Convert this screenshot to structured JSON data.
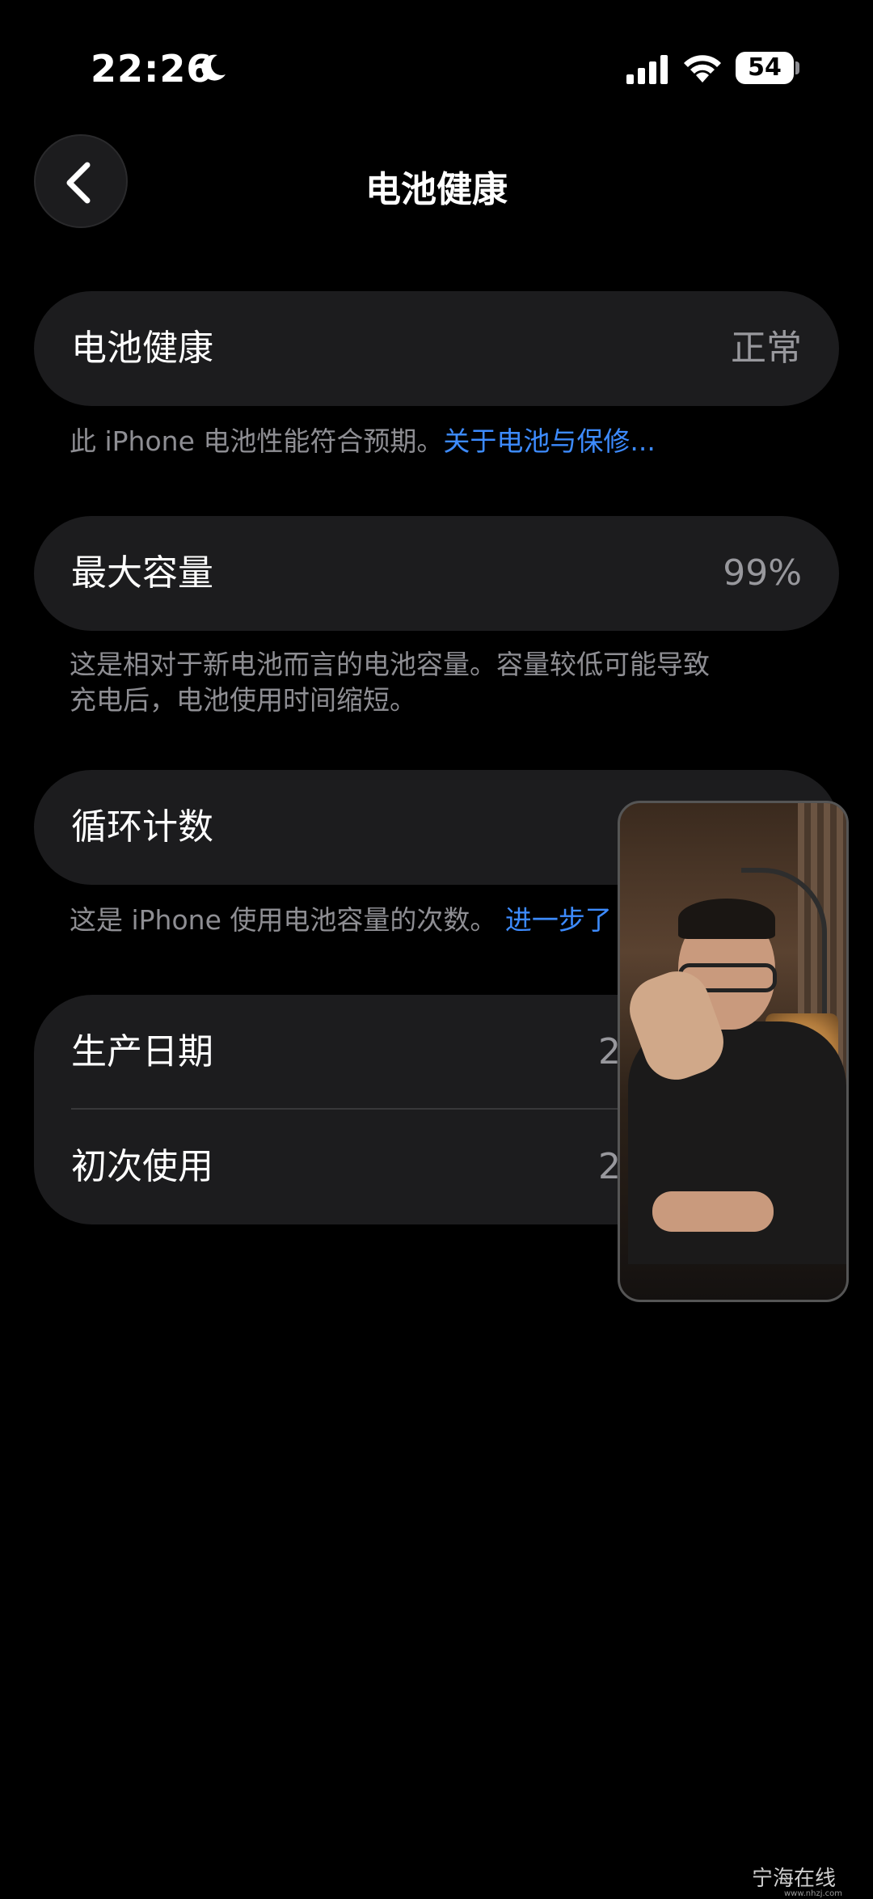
{
  "status_bar": {
    "time": "22:26",
    "battery_level": "54"
  },
  "nav": {
    "title": "电池健康",
    "back_icon": "chevron-left-icon"
  },
  "battery_health": {
    "label": "电池健康",
    "value": "正常",
    "note": "此 iPhone 电池性能符合预期。",
    "link": "关于电池与保修..."
  },
  "max_capacity": {
    "label": "最大容量",
    "value": "99%",
    "note_line1": "这是相对于新电池而言的电池容量。容量较低可能导致",
    "note_line2": "充电后，电池使用时间缩短。"
  },
  "cycle_count": {
    "label": "循环计数",
    "note": "这是 iPhone 使用电池容量的次数。",
    "link": "进一步了"
  },
  "dates": {
    "manufacture_label": "生产日期",
    "manufacture_value": "2",
    "first_use_label": "初次使用",
    "first_use_value": "2"
  },
  "watermark": {
    "name": "宁海在线",
    "url": "www.nhzj.com"
  }
}
